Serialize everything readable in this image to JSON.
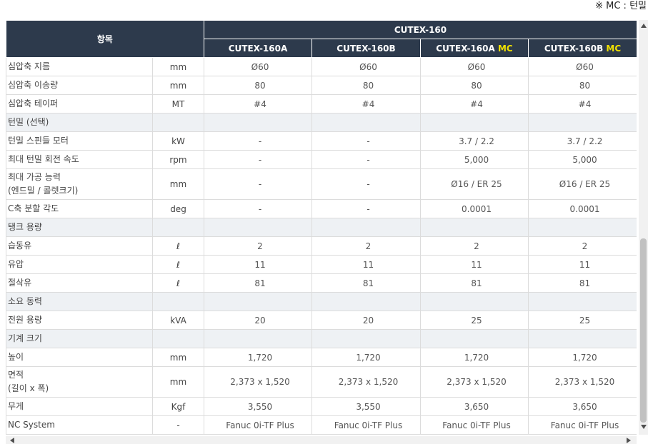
{
  "note": "※ MC : 턴밀",
  "header": {
    "item": "항목",
    "group": "CUTEX-160",
    "models": [
      {
        "name": "CUTEX-160A",
        "suffix": ""
      },
      {
        "name": "CUTEX-160B",
        "suffix": ""
      },
      {
        "name": "CUTEX-160A",
        "suffix": "MC"
      },
      {
        "name": "CUTEX-160B",
        "suffix": "MC"
      }
    ]
  },
  "rows": [
    {
      "label": "심압축 지름",
      "unit": "mm",
      "values": [
        "Ø60",
        "Ø60",
        "Ø60",
        "Ø60"
      ]
    },
    {
      "label": "심압축 이송량",
      "unit": "mm",
      "values": [
        "80",
        "80",
        "80",
        "80"
      ]
    },
    {
      "label": "심압축 테이퍼",
      "unit": "MT",
      "values": [
        "#4",
        "#4",
        "#4",
        "#4"
      ]
    },
    {
      "label": "턴밀 (선택)",
      "section": true
    },
    {
      "label": "턴밀 스핀들 모터",
      "unit": "kW",
      "values": [
        "-",
        "-",
        "3.7 / 2.2",
        "3.7 / 2.2"
      ]
    },
    {
      "label": "최대 턴밀 회전 속도",
      "unit": "rpm",
      "values": [
        "-",
        "-",
        "5,000",
        "5,000"
      ]
    },
    {
      "label": "최대 가공 능력",
      "label2": "(엔드밀 / 콜렛크기)",
      "unit": "mm",
      "values": [
        "-",
        "-",
        "Ø16 / ER 25",
        "Ø16 / ER 25"
      ]
    },
    {
      "label": "C축 분할 각도",
      "unit": "deg",
      "values": [
        "-",
        "-",
        "0.0001",
        "0.0001"
      ]
    },
    {
      "label": "탱크 용량",
      "section": true
    },
    {
      "label": "습동유",
      "unit": "ℓ",
      "values": [
        "2",
        "2",
        "2",
        "2"
      ]
    },
    {
      "label": "유압",
      "unit": "ℓ",
      "values": [
        "11",
        "11",
        "11",
        "11"
      ]
    },
    {
      "label": "절삭유",
      "unit": "ℓ",
      "values": [
        "81",
        "81",
        "81",
        "81"
      ]
    },
    {
      "label": "소요 동력",
      "section": true
    },
    {
      "label": "전원 용량",
      "unit": "kVA",
      "values": [
        "20",
        "20",
        "25",
        "25"
      ]
    },
    {
      "label": "기계 크기",
      "section": true
    },
    {
      "label": "높이",
      "unit": "mm",
      "values": [
        "1,720",
        "1,720",
        "1,720",
        "1,720"
      ]
    },
    {
      "label": "면적",
      "label2": "(길이 x 폭)",
      "unit": "mm",
      "values": [
        "2,373 x 1,520",
        "2,373 x 1,520",
        "2,373 x 1,520",
        "2,373 x 1,520"
      ]
    },
    {
      "label": "무게",
      "unit": "Kgf",
      "values": [
        "3,550",
        "3,550",
        "3,650",
        "3,650"
      ]
    },
    {
      "label": "NC System",
      "unit": "-",
      "values": [
        "Fanuc 0i-TF Plus",
        "Fanuc 0i-TF Plus",
        "Fanuc 0i-TF Plus",
        "Fanuc 0i-TF Plus"
      ]
    }
  ],
  "colors": {
    "header_bg": "#2d3a4c",
    "mc_accent": "#f0e000",
    "section_bg": "#eef1f4"
  }
}
